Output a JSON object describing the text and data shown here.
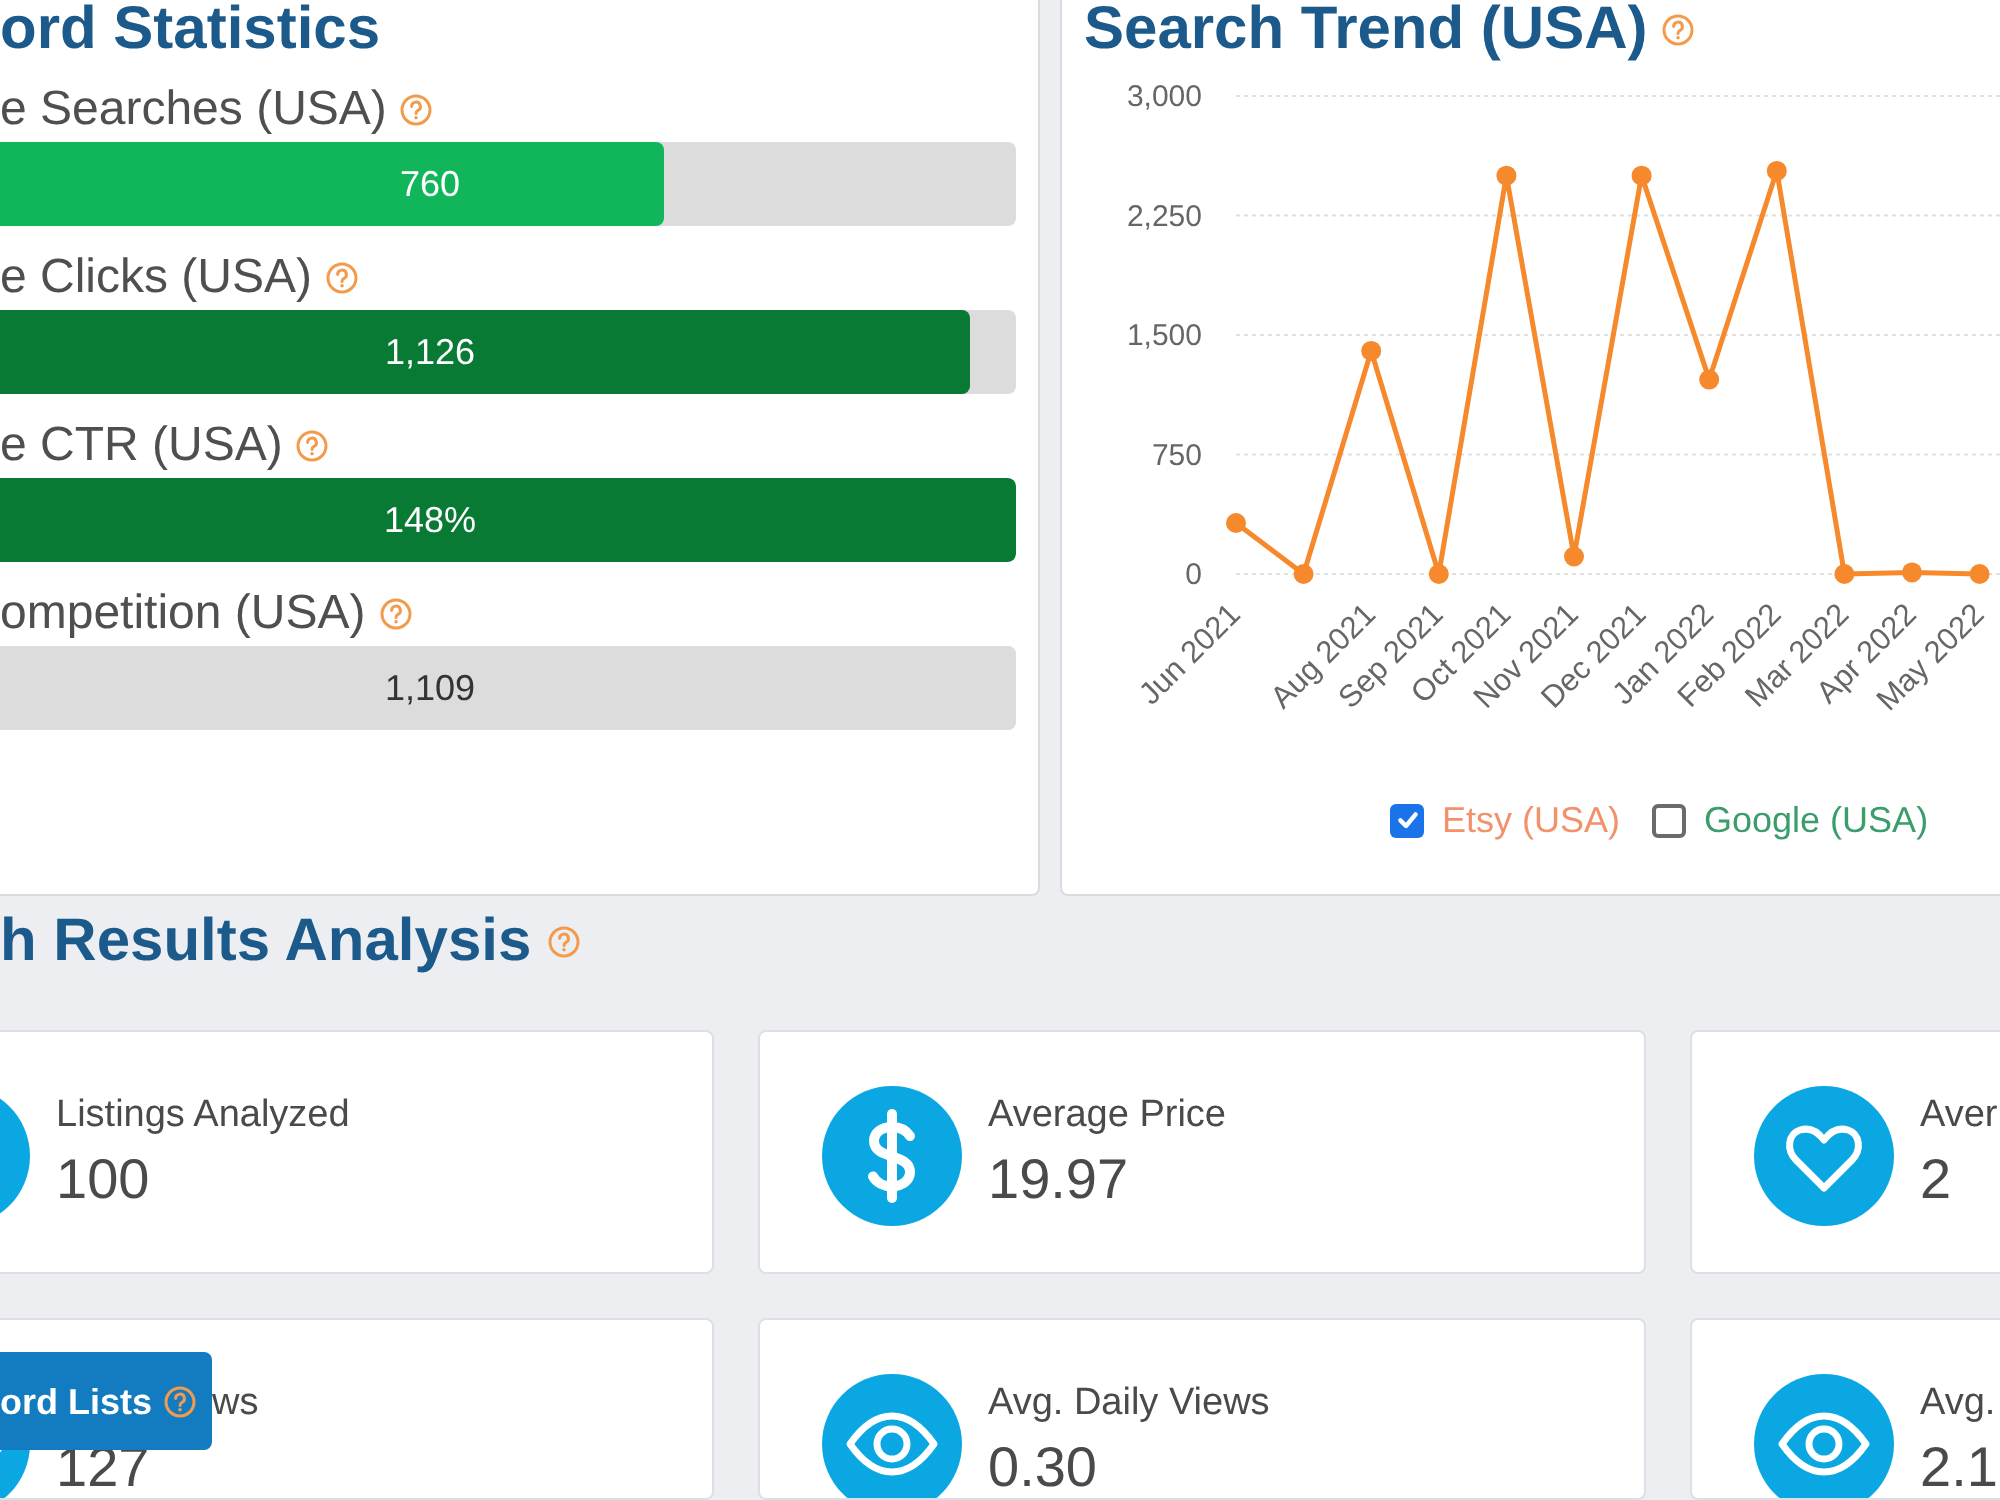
{
  "keyword_statistics": {
    "title": "ord Statistics",
    "metrics": [
      {
        "label": "e Searches (USA)",
        "reading": "760",
        "level": 0.7,
        "color": "#12b65a"
      },
      {
        "label": "e Clicks (USA)",
        "reading": "1,126",
        "level": 0.96,
        "color": "#087a34"
      },
      {
        "label": "e CTR (USA)",
        "reading": "148%",
        "level": 1,
        "color": "#087a34"
      },
      {
        "label": "ompetition (USA)",
        "reading": "1,109",
        "level": 1,
        "color": "#dcdcdc"
      }
    ]
  },
  "search_trend": {
    "title": "Search Trend (USA)",
    "chart_data": [
      {
        "type": "line",
        "categories": [
          "Jun 2021",
          null,
          "Aug 2021",
          "Sep 2021",
          "Oct 2021",
          "Nov 2021",
          "Dec 2021",
          "Jan 2022",
          "Feb 2022",
          "Mar 2022",
          "Apr 2022",
          "May 2022"
        ],
        "ylim": [
          0,
          3000
        ],
        "yticks": [
          {
            "value": 0,
            "label": "0"
          },
          {
            "value": 750,
            "label": "750"
          },
          {
            "value": 1500,
            "label": "1,500"
          },
          {
            "value": 2250,
            "label": "2,250"
          },
          {
            "value": 3000,
            "label": "3,000"
          }
        ],
        "grid": "y",
        "marker": "circle",
        "series": [
          {
            "color": "#f5892c",
            "values": [
              320,
              0,
              1400,
              0,
              2500,
              110,
              2500,
              1220,
              2530,
              0,
              10,
              0
            ]
          }
        ]
      }
    ],
    "legend": [
      {
        "label": "Etsy (USA)",
        "checked": true,
        "color": "#f2916a"
      },
      {
        "label": "Google (USA)",
        "checked": false,
        "color": "#3b9c6c"
      }
    ]
  },
  "search_results_analysis": {
    "title": "h Results Analysis",
    "rows": [
      {
        "cards": [
          {
            "kind": "listings",
            "label": "Listings Analyzed",
            "value": "100"
          },
          {
            "kind": "price",
            "label": "Average Price",
            "value": "19.97"
          },
          {
            "kind": "favorites",
            "label": "Aver",
            "value": "2"
          }
        ]
      },
      {
        "cards": [
          {
            "kind": "views",
            "label": "ws",
            "value": "127"
          },
          {
            "kind": "views",
            "label": "Avg. Daily Views",
            "value": "0.30"
          },
          {
            "kind": "views",
            "label": "Avg.",
            "value": "2.1"
          }
        ]
      }
    ]
  },
  "floating_tab": {
    "label": "ord Lists"
  }
}
